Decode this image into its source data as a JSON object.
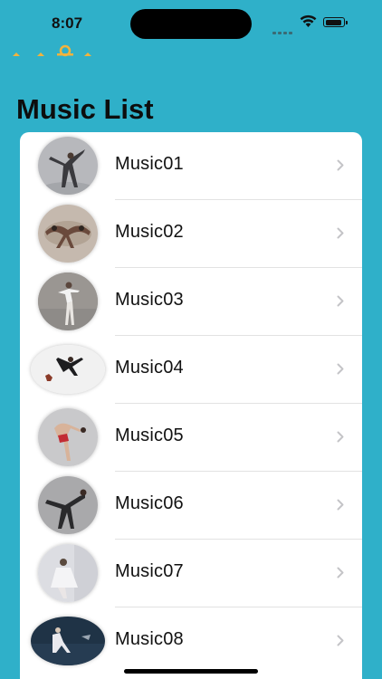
{
  "status": {
    "time": "8:07"
  },
  "page": {
    "title": "Music List"
  },
  "items": [
    {
      "label": "Music01"
    },
    {
      "label": "Music02"
    },
    {
      "label": "Music03"
    },
    {
      "label": "Music04"
    },
    {
      "label": "Music05"
    },
    {
      "label": "Music06"
    },
    {
      "label": "Music07"
    },
    {
      "label": "Music08"
    }
  ],
  "colors": {
    "background": "#2fb0c9",
    "card": "#ffffff",
    "chevron": "#c4c4c7",
    "deco": "#f2b33d"
  },
  "icons": [
    "wifi-icon",
    "battery-icon",
    "chevron-right-icon",
    "sun-decoration-icon"
  ]
}
